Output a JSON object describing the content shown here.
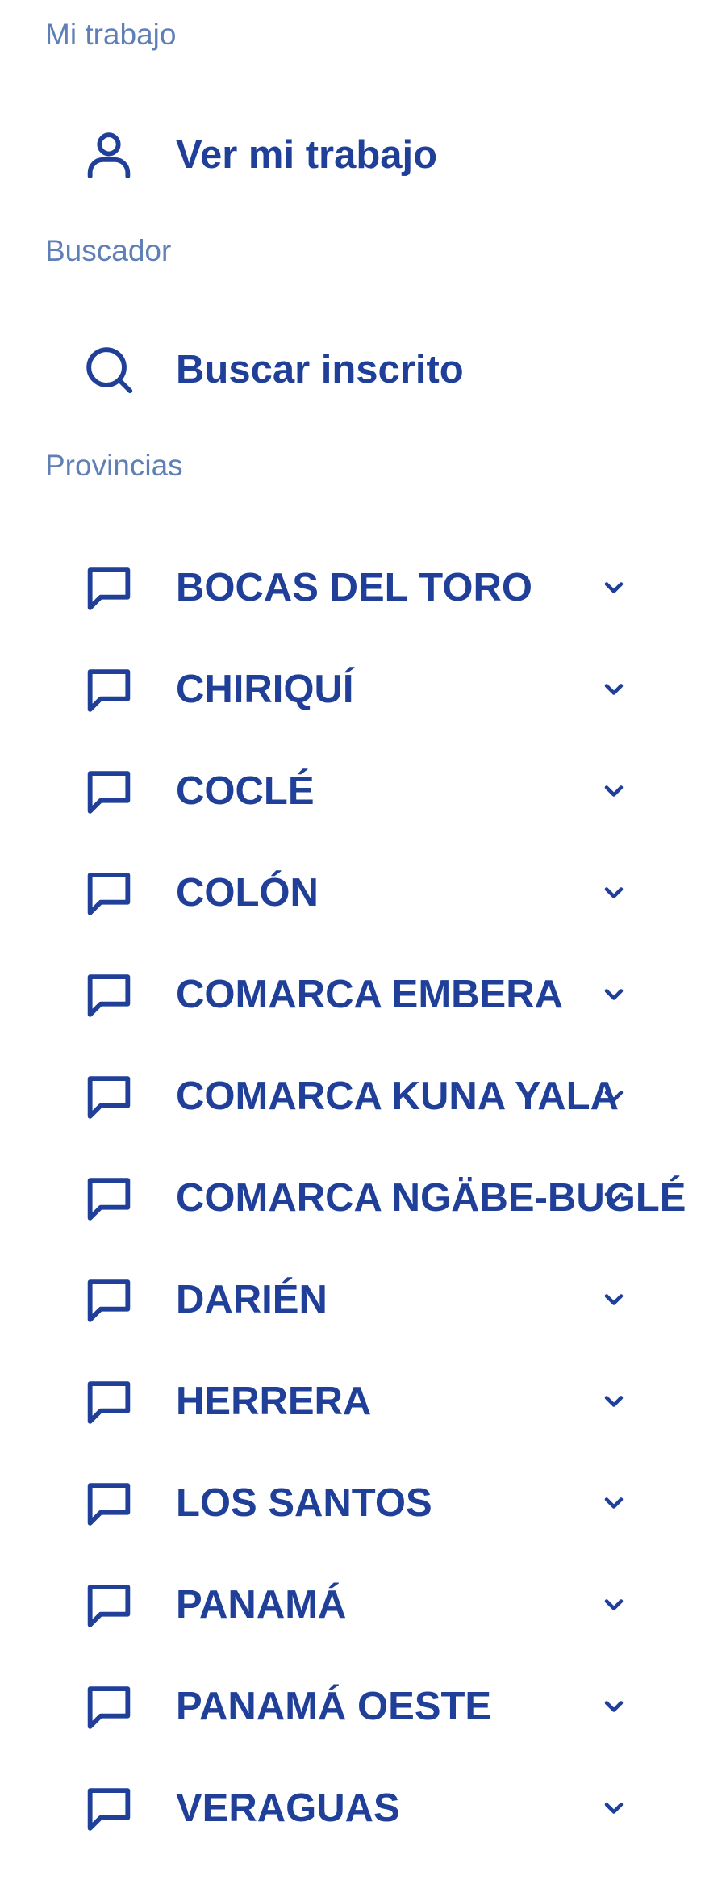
{
  "mi_trabajo": {
    "section_label": "Mi trabajo",
    "item_label": "Ver mi trabajo",
    "icon": "person-icon"
  },
  "buscador": {
    "section_label": "Buscador",
    "item_label": "Buscar inscrito",
    "icon": "search-icon"
  },
  "provincias": {
    "section_label": "Provincias",
    "icon": "chat-bubble-icon",
    "expand_icon": "chevron-down-icon",
    "items": [
      {
        "label": "BOCAS DEL TORO"
      },
      {
        "label": "CHIRIQUÍ"
      },
      {
        "label": "COCLÉ"
      },
      {
        "label": "COLÓN"
      },
      {
        "label": "COMARCA EMBERA"
      },
      {
        "label": "COMARCA KUNA YALA"
      },
      {
        "label": "COMARCA NGÄBE-BUGLÉ"
      },
      {
        "label": "DARIÉN"
      },
      {
        "label": "HERRERA"
      },
      {
        "label": "LOS SANTOS"
      },
      {
        "label": "PANAMÁ"
      },
      {
        "label": "PANAMÁ OESTE"
      },
      {
        "label": "VERAGUAS"
      }
    ]
  },
  "colors": {
    "primary": "#1f3f99",
    "section_label": "#5f7fb6",
    "background": "#ffffff"
  }
}
